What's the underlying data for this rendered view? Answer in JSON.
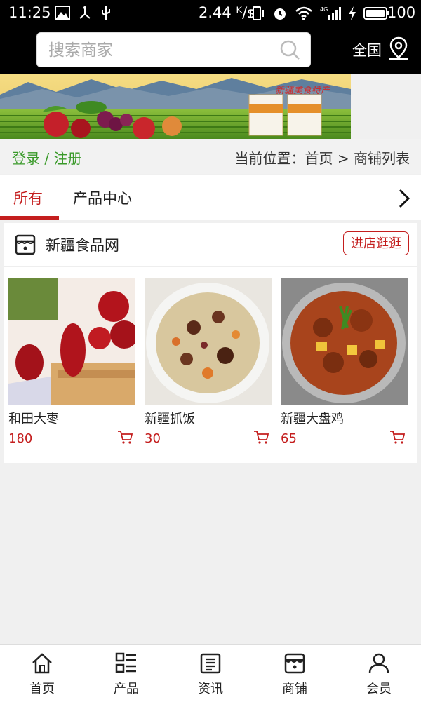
{
  "status_bar": {
    "time": "11:25",
    "speed": "2.44 ᴷ/s",
    "battery": "100"
  },
  "header": {
    "search_placeholder": "搜索商家",
    "region": "全国"
  },
  "banner": {
    "text": "新疆美食特产"
  },
  "crumb_bar": {
    "login": "登录",
    "separator": " / ",
    "register": "注册",
    "location": "当前位置：首页 > 商铺列表"
  },
  "tabs": [
    {
      "label": "所有",
      "active": true
    },
    {
      "label": "产品中心",
      "active": false
    }
  ],
  "shop": {
    "name": "新疆食品网",
    "visit_button": "进店逛逛",
    "products": [
      {
        "name": "和田大枣",
        "price": "180"
      },
      {
        "name": "新疆抓饭",
        "price": "30"
      },
      {
        "name": "新疆大盘鸡",
        "price": "65"
      }
    ]
  },
  "bottom_nav": [
    {
      "label": "首页",
      "icon": "home-icon"
    },
    {
      "label": "产品",
      "icon": "grid-list-icon"
    },
    {
      "label": "资讯",
      "icon": "news-icon"
    },
    {
      "label": "商铺",
      "icon": "store-icon"
    },
    {
      "label": "会员",
      "icon": "user-icon"
    }
  ],
  "colors": {
    "accent": "#c41e1e",
    "login_green": "#3a9a2a",
    "header_bg": "#000000"
  }
}
